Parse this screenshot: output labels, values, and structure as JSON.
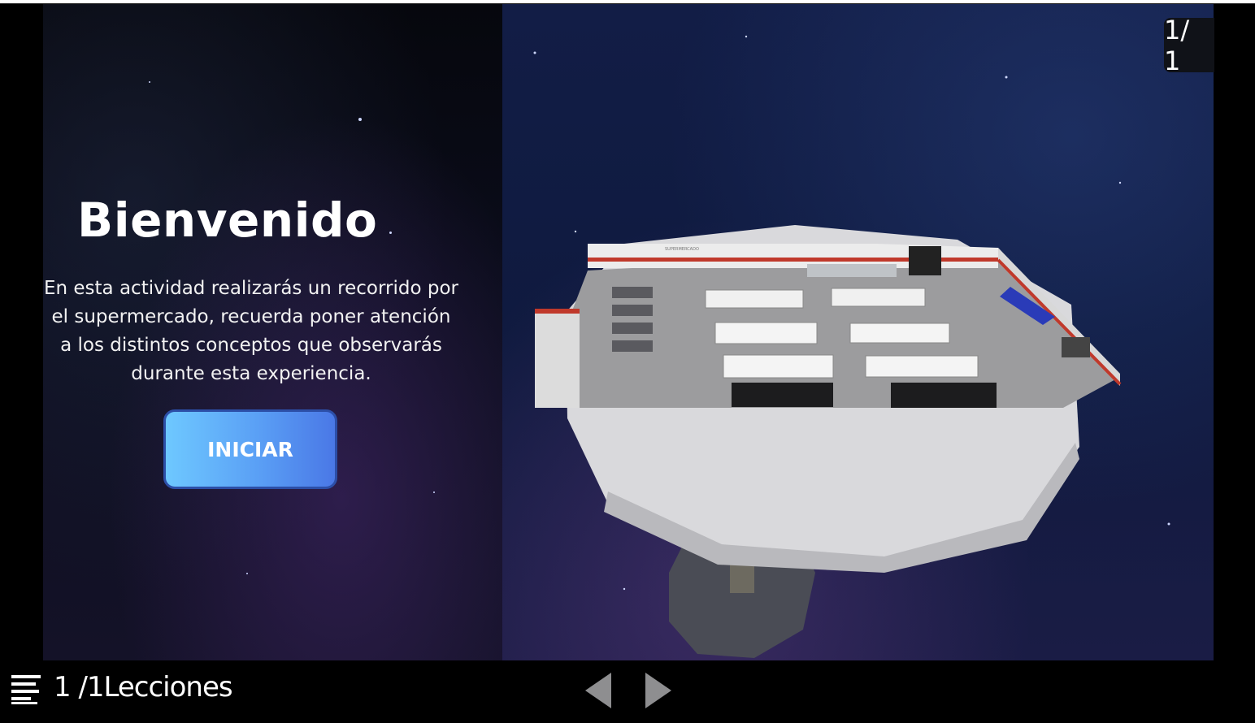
{
  "welcome": {
    "title": "Bienvenido",
    "description": "En esta actividad realizarás un recorrido por el supermercado, recuerda poner atención a los distintos conceptos que observarás durante esta experiencia.",
    "start_label": "INICIAR"
  },
  "scene": {
    "store_sign": "SUPERMERCADO"
  },
  "page_counter": "1/ 1",
  "bottom_bar": {
    "menu_icon": "hamburger-menu-icon",
    "lesson_counter": "1 /1Lecciones",
    "prev_icon": "triangle-left-icon",
    "next_icon": "triangle-right-icon"
  },
  "colors": {
    "button_start": "#6ec8ff",
    "button_end": "#4a78e6",
    "button_border": "#2c4fa8",
    "store_accent": "#c0392b"
  }
}
